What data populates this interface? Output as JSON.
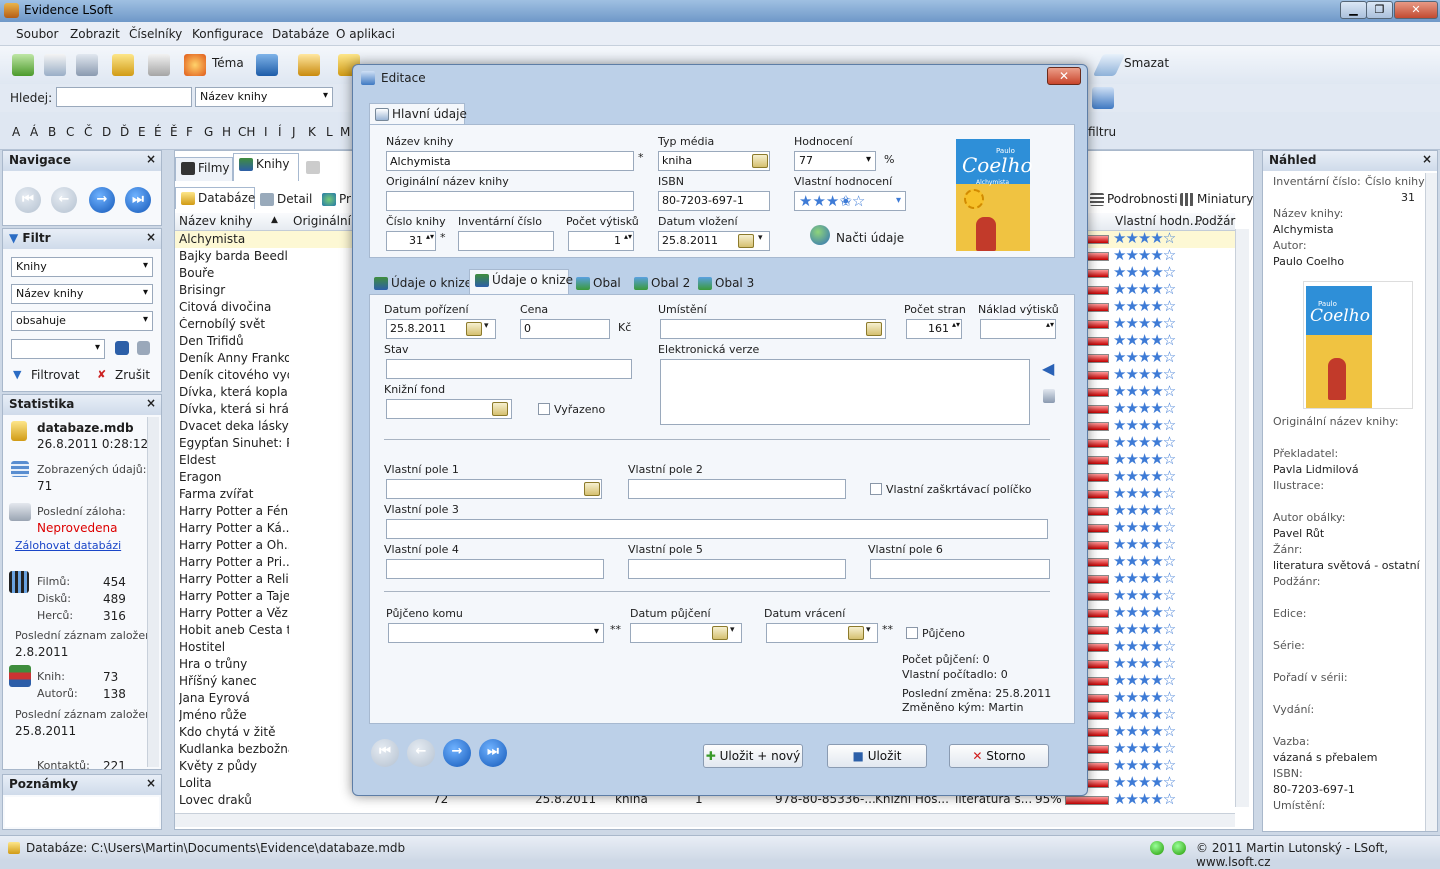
{
  "window": {
    "title": "Evidence LSoft"
  },
  "menu": [
    "Soubor",
    "Zobrazit",
    "Číselníky",
    "Konfigurace",
    "Databáze",
    "O aplikaci"
  ],
  "toolbar": {
    "theme_label": "Téma",
    "delete_label": "Smazat"
  },
  "search": {
    "label": "Hledej:",
    "value": "",
    "field": "Název knihy",
    "filter_label": "filtru"
  },
  "alphabet": [
    "A",
    "Á",
    "B",
    "C",
    "Č",
    "D",
    "Ď",
    "E",
    "É",
    "Ě",
    "F",
    "G",
    "H",
    "CH",
    "I",
    "Í",
    "J",
    "K",
    "L",
    "M"
  ],
  "navigace": {
    "title": "Navigace"
  },
  "filtr": {
    "title": "Filtr",
    "type": "Knihy",
    "field": "Název knihy",
    "op": "obsahuje",
    "apply": "Filtrovat",
    "cancel": "Zrušit"
  },
  "statistika": {
    "title": "Statistika",
    "db": "databaze.mdb",
    "db_date": "26.8.2011 0:28:12",
    "shown_label": "Zobrazených údajů:",
    "shown": "71",
    "backup_label": "Poslední záloha:",
    "backup": "Neprovedena",
    "backup_link": "Zálohovat databázi",
    "films_label": "Filmů:",
    "films": "454",
    "discs_label": "Disků:",
    "discs": "489",
    "actors_label": "Herců:",
    "actors": "316",
    "last_label1": "Poslední záznam založen:",
    "last1": "2.8.2011",
    "books_label": "Knih:",
    "books": "73",
    "authors_label": "Autorů:",
    "authors": "138",
    "last_label2": "Poslední záznam založen:",
    "last2": "25.8.2011",
    "contacts_label": "Kontaktů:",
    "contacts": "221"
  },
  "poznamky": {
    "title": "Poznámky"
  },
  "main_tabs": {
    "filmy": "Filmy",
    "knihy": "Knihy",
    "pr": "Pr"
  },
  "sub_tabs": {
    "databaze": "Databáze",
    "detail": "Detail",
    "pr": "Pr",
    "podrobnosti": "Podrobnosti",
    "miniatury": "Miniatury"
  },
  "columns": {
    "name": "Název knihy",
    "orig": "Originální",
    "rating": "Vlastní hodn...",
    "podzar": "Podžár"
  },
  "books": [
    "Alchymista",
    "Bajky barda Beedl...",
    "Bouře",
    "Brisingr",
    "Citová divočina",
    "Černobílý svět",
    "Den Trifidů",
    "Deník Anny Franko...",
    "Deník citového vyd...",
    "Dívka, která kopla ...",
    "Dívka, která si hrá...",
    "Dvacet deka lásky",
    "Egypťan Sinuhet: P...",
    "Eldest",
    "Eragon",
    "Farma zvířat",
    "Harry Potter a Fén...",
    "Harry Potter a Ká...",
    "Harry Potter a Oh...",
    "Harry Potter a Pri...",
    "Harry Potter a Reli...",
    "Harry Potter a Taje...",
    "Harry Potter a Věz...",
    "Hobit aneb Cesta t...",
    "Hostitel",
    "Hra o trůny",
    "Hříšný kanec",
    "Jana Eyrová",
    "Jméno růže",
    "Kdo chytá v žitě",
    "Kudlanka bezbožná",
    "Květy z půdy",
    "Lolita",
    "Lovec draků"
  ],
  "list_tail": {
    "num": "72",
    "date": "25.8.2011",
    "type": "kniha",
    "count": "1",
    "isbn": "978-80-85336-...",
    "pub": "Knižní Hos...",
    "genre": "literatura s...",
    "pct": "95%"
  },
  "list_partial": {
    "date": "25.8.2011",
    "type": "kniha"
  },
  "dialog": {
    "title": "Editace",
    "tab_main": "Hlavní údaje",
    "name_label": "Název knihy",
    "name": "Alchymista",
    "orig_label": "Originální název knihy",
    "orig": "",
    "num_label": "Číslo knihy",
    "num": "31",
    "inv_label": "Inventární číslo",
    "inv": "",
    "copies_label": "Počet výtisků",
    "copies": "1",
    "media_label": "Typ média",
    "media": "kniha",
    "isbn_label": "ISBN",
    "isbn": "80-7203-697-1",
    "date_label": "Datum vložení",
    "date": "25.8.2011",
    "rating_label": "Hodnocení",
    "rating": "77",
    "pct": "%",
    "own_rating_label": "Vlastní hodnocení",
    "own_stars": 3.5,
    "load_label": "Načti údaje",
    "cover": {
      "author": "Paulo",
      "title": "Coelho",
      "sub": "Alchymista"
    },
    "tabs": [
      "Údaje o knize",
      "Údaje o knize",
      "Obal",
      "Obal 2",
      "Obal 3"
    ],
    "acq_label": "Datum pořízení",
    "acq": "25.8.2011",
    "price_label": "Cena",
    "price": "0",
    "currency": "Kč",
    "loc_label": "Umístění",
    "loc": "",
    "pages_label": "Počet stran",
    "pages": "161",
    "print_label": "Náklad výtisků",
    "print": "",
    "state_label": "Stav",
    "state": "",
    "ebook_label": "Elektronická verze",
    "fund_label": "Knižní fond",
    "fund": "",
    "discarded": "Vyřazeno",
    "cf1": "Vlastní pole 1",
    "cf2": "Vlastní pole 2",
    "cf_check": "Vlastní zaškrtávací políčko",
    "cf3": "Vlastní pole 3",
    "cf4": "Vlastní pole 4",
    "cf5": "Vlastní pole 5",
    "cf6": "Vlastní pole 6",
    "lent_to": "Půjčeno komu",
    "lent_date": "Datum půjčení",
    "return_date": "Datum vrácení",
    "lent": "Půjčeno",
    "stars2": "**",
    "loans": "Počet půjčení: 0",
    "counter": "Vlastní počítadlo: 0",
    "last_change": "Poslední změna: 25.8.2011",
    "changed_by": "Změněno kým: Martin",
    "btn_save_new": "Uložit + nový",
    "btn_save": "Uložit",
    "btn_cancel": "Storno"
  },
  "preview": {
    "title": "Náhled",
    "inv_label": "Inventární číslo:",
    "num_label": "Číslo knihy:",
    "num": "31",
    "name_label": "Název knihy:",
    "name": "Alchymista",
    "author_label": "Autor:",
    "author": "Paulo Coelho",
    "orig_label": "Originální název knihy:",
    "translator_label": "Překladatel:",
    "translator": "Pavla Lidmilová",
    "illus_label": "Ilustrace:",
    "cover_author_label": "Autor obálky:",
    "cover_author": "Pavel Růt",
    "genre_label": "Žánr:",
    "genre": "literatura světová - ostatní",
    "subgenre_label": "Podžánr:",
    "edition_label": "Edice:",
    "series_label": "Série:",
    "order_label": "Pořadí v sérii:",
    "published_label": "Vydání:",
    "binding_label": "Vazba:",
    "binding": "vázaná s přebalem",
    "isbn_label": "ISBN:",
    "isbn": "80-7203-697-1",
    "loc_label": "Umístění:"
  },
  "status": {
    "db": "Databáze: C:\\Users\\Martin\\Documents\\Evidence\\databaze.mdb",
    "copy": "© 2011 Martin Lutonský - LSoft, www.lsoft.cz"
  }
}
